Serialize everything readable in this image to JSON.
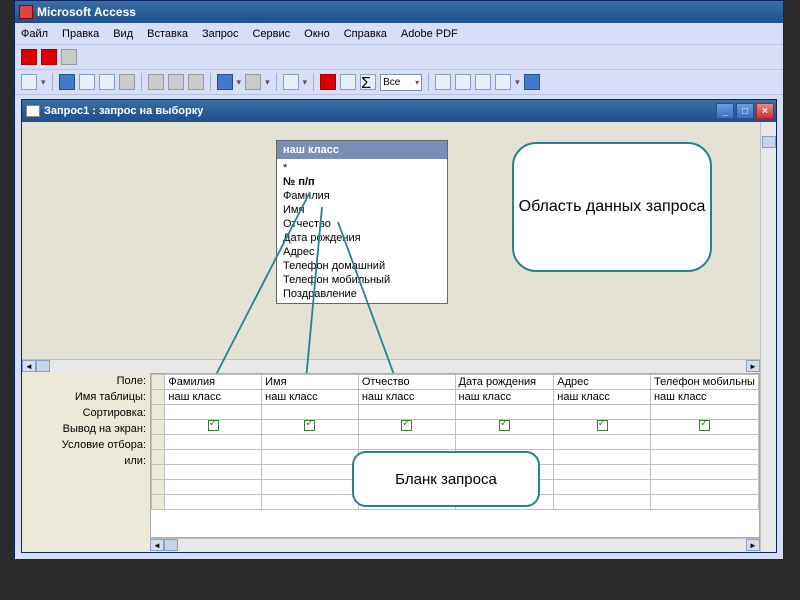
{
  "app": {
    "title": "Microsoft Access"
  },
  "menu": [
    "Файл",
    "Правка",
    "Вид",
    "Вставка",
    "Запрос",
    "Сервис",
    "Окно",
    "Справка",
    "Adobe PDF"
  ],
  "toolbar2_combo": "Все",
  "inner_window": {
    "title": "Запрос1 : запрос на выборку"
  },
  "table_box": {
    "title": "наш класс",
    "fields": [
      "*",
      "№ п/п",
      "Фамилия",
      "Имя",
      "Отчество",
      "Дата рождения",
      "Адрес",
      "Телефон домашний",
      "Телефон мобильный",
      "Поздравление"
    ]
  },
  "callout_data": "Область данных запроса",
  "callout_blank": "Бланк запроса",
  "row_labels": [
    "Поле:",
    "Имя таблицы:",
    "Сортировка:",
    "Вывод на экран:",
    "Условие отбора:",
    "или:"
  ],
  "columns": [
    {
      "field": "Фамилия",
      "table": "наш класс",
      "show": true
    },
    {
      "field": "Имя",
      "table": "наш класс",
      "show": true
    },
    {
      "field": "Отчество",
      "table": "наш класс",
      "show": true
    },
    {
      "field": "Дата рождения",
      "table": "наш класс",
      "show": true
    },
    {
      "field": "Адрес",
      "table": "наш класс",
      "show": true
    },
    {
      "field": "Телефон мобильны",
      "table": "наш класс",
      "show": true
    }
  ]
}
